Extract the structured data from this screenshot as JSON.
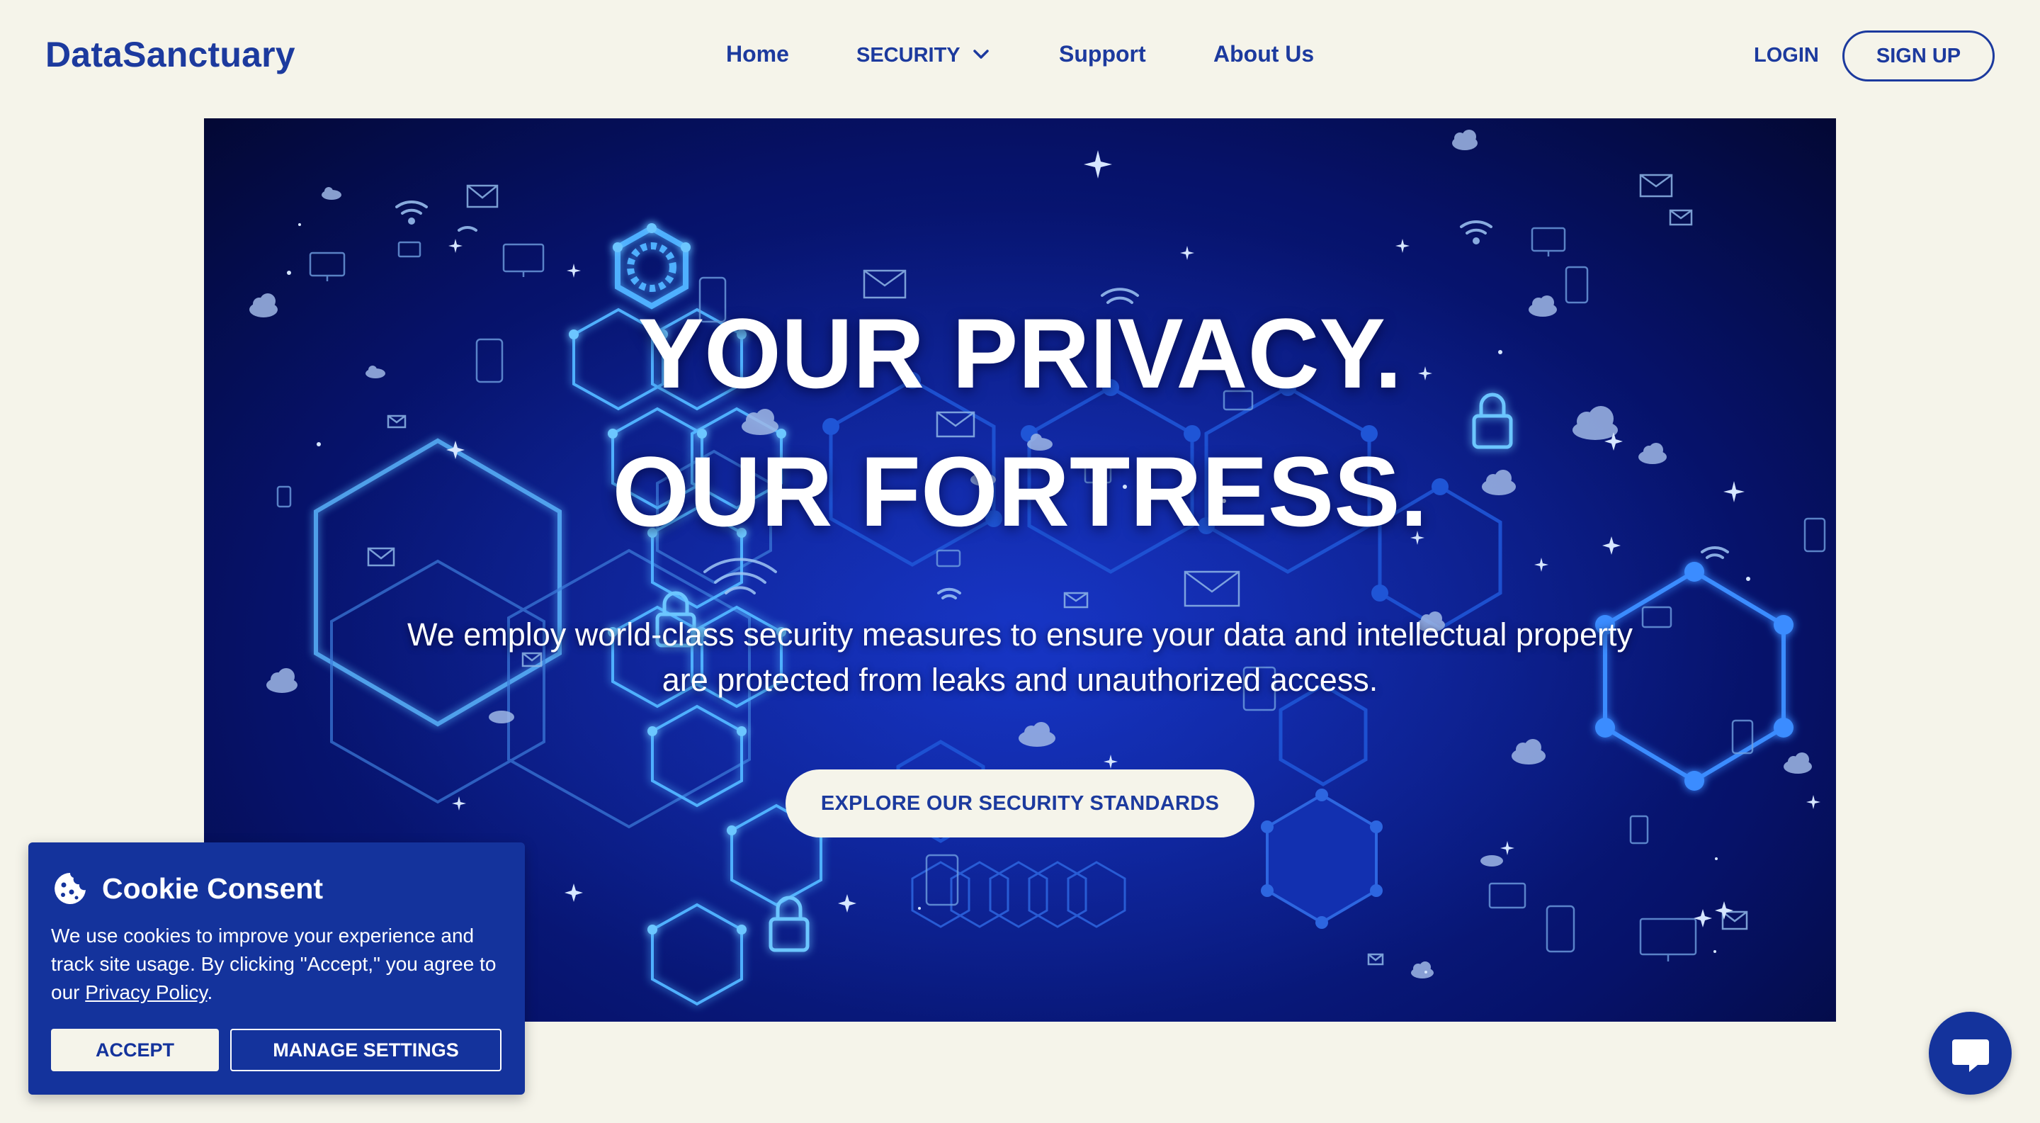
{
  "header": {
    "logo": "DataSanctuary",
    "nav": {
      "home": "Home",
      "security": "SECURITY",
      "support": "Support",
      "about": "About Us"
    },
    "login": "LOGIN",
    "signup": "SIGN UP"
  },
  "hero": {
    "title_line1": "YOUR PRIVACY.",
    "title_line2": "OUR FORTRESS.",
    "subtitle": "We employ world-class security measures to ensure your data and intellectual property are protected from leaks and unauthorized access.",
    "cta": "EXPLORE OUR SECURITY STANDARDS"
  },
  "cookie": {
    "title": "Cookie Consent",
    "text_before_link": "We use cookies to improve your experience and track site usage. By clicking \"Accept,\" you agree to our ",
    "link": "Privacy Policy",
    "text_after_link": ".",
    "accept": "ACCEPT",
    "manage": "MANAGE SETTINGS"
  },
  "icons": {
    "nav_chevron": "chevron-down-icon",
    "cookie": "cookie-icon",
    "chat": "chat-bubble-icon"
  },
  "colors": {
    "brand": "#1c3a9e",
    "background": "#f5f4ea",
    "cookie_panel": "#14339c",
    "hero_dark": "#030834"
  }
}
